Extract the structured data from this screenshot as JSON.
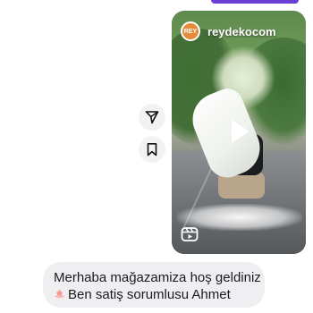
{
  "reel": {
    "username": "reydekocom",
    "avatar_text": "REY",
    "play_icon": "play-icon",
    "reels_icon": "reels-icon"
  },
  "side_actions": [
    {
      "icon": "share-icon"
    },
    {
      "icon": "bookmark-icon"
    }
  ],
  "message": {
    "line1": "Merhaba mağazamiza hoş geldiniz",
    "line2": "Ben satiş sorumlusu Ahmet",
    "emoji_icon": "lotus-emoji-icon"
  },
  "colors": {
    "top_bar": "#6c3ed6",
    "bubble_bg": "#efeff1",
    "side_btn_bg": "#f2f2f4",
    "avatar_bg": "#e58a3a"
  }
}
